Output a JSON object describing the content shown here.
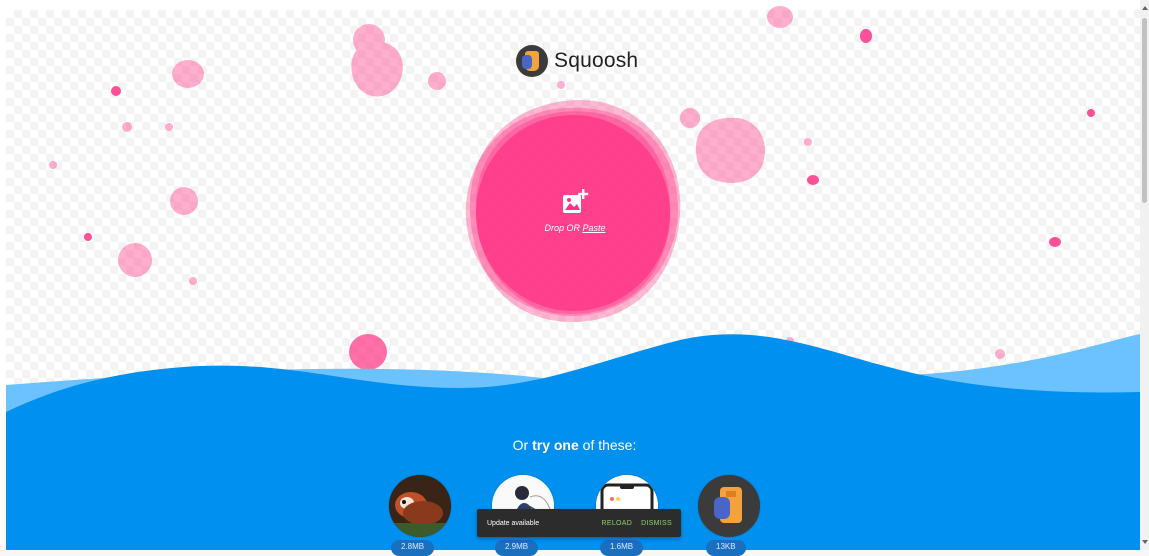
{
  "app": {
    "name": "Squoosh"
  },
  "dropzone": {
    "drop_label": "Drop OR ",
    "paste_label": "Paste"
  },
  "demos": {
    "intro_before": "Or ",
    "intro_bold": "try one",
    "intro_after": " of these:",
    "items": [
      {
        "name": "red-panda",
        "size": "2.8MB"
      },
      {
        "name": "artwork",
        "size": "2.9MB"
      },
      {
        "name": "device-screen",
        "size": "1.6MB"
      },
      {
        "name": "squoosh-logo",
        "size": "13KB"
      }
    ]
  },
  "snackbar": {
    "message": "Update available",
    "reload": "RELOAD",
    "dismiss": "DISMISS"
  },
  "colors": {
    "accent_pink": "#ff3385",
    "wave_blue": "#0090f0",
    "wave_light": "#6cc2ff",
    "snack_action": "#8fd16b"
  }
}
